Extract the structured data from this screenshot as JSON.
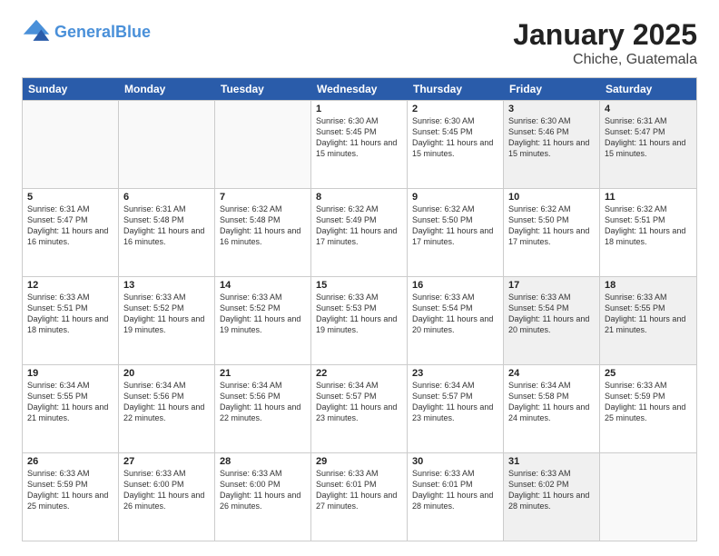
{
  "header": {
    "logo_line1": "General",
    "logo_line2": "Blue",
    "main_title": "January 2025",
    "subtitle": "Chiche, Guatemala"
  },
  "days_of_week": [
    "Sunday",
    "Monday",
    "Tuesday",
    "Wednesday",
    "Thursday",
    "Friday",
    "Saturday"
  ],
  "weeks": [
    [
      {
        "day": "",
        "info": "",
        "empty": true
      },
      {
        "day": "",
        "info": "",
        "empty": true
      },
      {
        "day": "",
        "info": "",
        "empty": true
      },
      {
        "day": "1",
        "info": "Sunrise: 6:30 AM\nSunset: 5:45 PM\nDaylight: 11 hours\nand 15 minutes."
      },
      {
        "day": "2",
        "info": "Sunrise: 6:30 AM\nSunset: 5:45 PM\nDaylight: 11 hours\nand 15 minutes."
      },
      {
        "day": "3",
        "info": "Sunrise: 6:30 AM\nSunset: 5:46 PM\nDaylight: 11 hours\nand 15 minutes."
      },
      {
        "day": "4",
        "info": "Sunrise: 6:31 AM\nSunset: 5:47 PM\nDaylight: 11 hours\nand 15 minutes."
      }
    ],
    [
      {
        "day": "5",
        "info": "Sunrise: 6:31 AM\nSunset: 5:47 PM\nDaylight: 11 hours\nand 16 minutes."
      },
      {
        "day": "6",
        "info": "Sunrise: 6:31 AM\nSunset: 5:48 PM\nDaylight: 11 hours\nand 16 minutes."
      },
      {
        "day": "7",
        "info": "Sunrise: 6:32 AM\nSunset: 5:48 PM\nDaylight: 11 hours\nand 16 minutes."
      },
      {
        "day": "8",
        "info": "Sunrise: 6:32 AM\nSunset: 5:49 PM\nDaylight: 11 hours\nand 17 minutes."
      },
      {
        "day": "9",
        "info": "Sunrise: 6:32 AM\nSunset: 5:50 PM\nDaylight: 11 hours\nand 17 minutes."
      },
      {
        "day": "10",
        "info": "Sunrise: 6:32 AM\nSunset: 5:50 PM\nDaylight: 11 hours\nand 17 minutes."
      },
      {
        "day": "11",
        "info": "Sunrise: 6:32 AM\nSunset: 5:51 PM\nDaylight: 11 hours\nand 18 minutes."
      }
    ],
    [
      {
        "day": "12",
        "info": "Sunrise: 6:33 AM\nSunset: 5:51 PM\nDaylight: 11 hours\nand 18 minutes."
      },
      {
        "day": "13",
        "info": "Sunrise: 6:33 AM\nSunset: 5:52 PM\nDaylight: 11 hours\nand 19 minutes."
      },
      {
        "day": "14",
        "info": "Sunrise: 6:33 AM\nSunset: 5:52 PM\nDaylight: 11 hours\nand 19 minutes."
      },
      {
        "day": "15",
        "info": "Sunrise: 6:33 AM\nSunset: 5:53 PM\nDaylight: 11 hours\nand 19 minutes."
      },
      {
        "day": "16",
        "info": "Sunrise: 6:33 AM\nSunset: 5:54 PM\nDaylight: 11 hours\nand 20 minutes."
      },
      {
        "day": "17",
        "info": "Sunrise: 6:33 AM\nSunset: 5:54 PM\nDaylight: 11 hours\nand 20 minutes."
      },
      {
        "day": "18",
        "info": "Sunrise: 6:33 AM\nSunset: 5:55 PM\nDaylight: 11 hours\nand 21 minutes."
      }
    ],
    [
      {
        "day": "19",
        "info": "Sunrise: 6:34 AM\nSunset: 5:55 PM\nDaylight: 11 hours\nand 21 minutes."
      },
      {
        "day": "20",
        "info": "Sunrise: 6:34 AM\nSunset: 5:56 PM\nDaylight: 11 hours\nand 22 minutes."
      },
      {
        "day": "21",
        "info": "Sunrise: 6:34 AM\nSunset: 5:56 PM\nDaylight: 11 hours\nand 22 minutes."
      },
      {
        "day": "22",
        "info": "Sunrise: 6:34 AM\nSunset: 5:57 PM\nDaylight: 11 hours\nand 23 minutes."
      },
      {
        "day": "23",
        "info": "Sunrise: 6:34 AM\nSunset: 5:57 PM\nDaylight: 11 hours\nand 23 minutes."
      },
      {
        "day": "24",
        "info": "Sunrise: 6:34 AM\nSunset: 5:58 PM\nDaylight: 11 hours\nand 24 minutes."
      },
      {
        "day": "25",
        "info": "Sunrise: 6:33 AM\nSunset: 5:59 PM\nDaylight: 11 hours\nand 25 minutes."
      }
    ],
    [
      {
        "day": "26",
        "info": "Sunrise: 6:33 AM\nSunset: 5:59 PM\nDaylight: 11 hours\nand 25 minutes."
      },
      {
        "day": "27",
        "info": "Sunrise: 6:33 AM\nSunset: 6:00 PM\nDaylight: 11 hours\nand 26 minutes."
      },
      {
        "day": "28",
        "info": "Sunrise: 6:33 AM\nSunset: 6:00 PM\nDaylight: 11 hours\nand 26 minutes."
      },
      {
        "day": "29",
        "info": "Sunrise: 6:33 AM\nSunset: 6:01 PM\nDaylight: 11 hours\nand 27 minutes."
      },
      {
        "day": "30",
        "info": "Sunrise: 6:33 AM\nSunset: 6:01 PM\nDaylight: 11 hours\nand 28 minutes."
      },
      {
        "day": "31",
        "info": "Sunrise: 6:33 AM\nSunset: 6:02 PM\nDaylight: 11 hours\nand 28 minutes."
      },
      {
        "day": "",
        "info": "",
        "empty": true
      }
    ]
  ]
}
